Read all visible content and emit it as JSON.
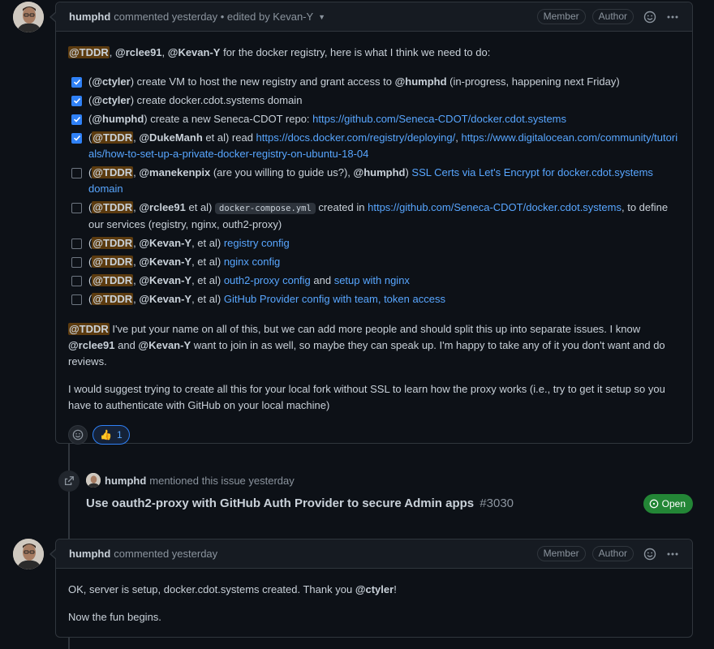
{
  "comment1": {
    "author": "humphd",
    "meta": "commented yesterday • edited by Kevan-Y",
    "badges": [
      "Member",
      "Author"
    ],
    "intro": {
      "m1": "@TDDR",
      "sep1": ", ",
      "m2": "@rclee91",
      "sep2": ", ",
      "m3": "@Kevan-Y",
      "text": " for the docker registry, here is what I think we need to do:"
    },
    "tasks": [
      {
        "checked": true,
        "prefix": "(",
        "m1": "@ctyler",
        "t1": ") create VM to host the new registry and grant access to ",
        "m2": "@humphd",
        "t2": " (in-progress, happening next Friday)"
      },
      {
        "checked": true,
        "prefix": "(",
        "m1": "@ctyler",
        "t1": ") create docker.cdot.systems domain"
      },
      {
        "checked": true,
        "prefix": "(",
        "m1": "@humphd",
        "t1": ") create a new Seneca-CDOT repo: ",
        "link1": "https://github.com/Seneca-CDOT/docker.cdot.systems"
      },
      {
        "checked": true,
        "prefix": "(",
        "m1": "@TDDR",
        "t1": ", ",
        "m2": "@DukeManh",
        "t2": " et al) read ",
        "link1": "https://docs.docker.com/registry/deploying/",
        "t3": ", ",
        "link2": "https://www.digitalocean.com/community/tutorials/how-to-set-up-a-private-docker-registry-on-ubuntu-18-04"
      },
      {
        "checked": false,
        "prefix": "(",
        "m1": "@TDDR",
        "t1": ", ",
        "m2": "@manekenpix",
        "t2": " (are you willing to guide us?), ",
        "m3": "@humphd",
        "t3": ") ",
        "link1": "SSL Certs via Let's Encrypt for docker.cdot.systems domain"
      },
      {
        "checked": false,
        "prefix": "(",
        "m1": "@TDDR",
        "t1": ", ",
        "m2": "@rclee91",
        "t2": " et al) ",
        "code": "docker-compose.yml",
        "t3": " created in ",
        "link1": "https://github.com/Seneca-CDOT/docker.cdot.systems",
        "t4": ", to define our services (registry, nginx, outh2-proxy)"
      },
      {
        "checked": false,
        "prefix": "(",
        "m1": "@TDDR",
        "t1": ", ",
        "m2": "@Kevan-Y",
        "t2": ", et al) ",
        "link1": "registry config"
      },
      {
        "checked": false,
        "prefix": "(",
        "m1": "@TDDR",
        "t1": ", ",
        "m2": "@Kevan-Y",
        "t2": ", et al) ",
        "link1": "nginx config"
      },
      {
        "checked": false,
        "prefix": "(",
        "m1": "@TDDR",
        "t1": ", ",
        "m2": "@Kevan-Y",
        "t2": ", et al) ",
        "link1": "outh2-proxy config",
        "t3": " and ",
        "link2": "setup with nginx"
      },
      {
        "checked": false,
        "prefix": "(",
        "m1": "@TDDR",
        "t1": ", ",
        "m2": "@Kevan-Y",
        "t2": ", et al) ",
        "link1": "GitHub Provider config with team, token access"
      }
    ],
    "para1": {
      "m1": "@TDDR",
      "t1": " I've put your name on all of this, but we can add more people and should split this up into separate issues. I know ",
      "m2": "@rclee91",
      "t2": " and ",
      "m3": "@Kevan-Y",
      "t3": " want to join in as well, so maybe they can speak up. I'm happy to take any of it you don't want and do reviews."
    },
    "para2": "I would suggest trying to create all this for your local fork without SSL to learn how the proxy works (i.e., try to get it setup so you have to authenticate with GitHub on your local machine)",
    "reaction": {
      "emoji": "👍",
      "count": "1"
    }
  },
  "event": {
    "author": "humphd",
    "meta": "mentioned this issue yesterday",
    "title": "Use oauth2-proxy with GitHub Auth Provider to secure Admin apps",
    "number": "#3030",
    "state": "Open"
  },
  "comment2": {
    "author": "humphd",
    "meta": "commented yesterday",
    "badges": [
      "Member",
      "Author"
    ],
    "p1_text": "OK, server is setup, docker.cdot.systems created. Thank you ",
    "p1_mention": "@ctyler",
    "p1_end": "!",
    "p2": "Now the fun begins."
  },
  "colors": {
    "background": "#0d1117",
    "header": "#161b22",
    "border": "#30363d",
    "link": "#58a6ff",
    "checkbox": "#2f81f7",
    "open_badge": "#238636",
    "mention_highlight": "#5c3b0f"
  },
  "icons": [
    "smiley-icon",
    "kebab-icon",
    "caret-down-icon",
    "check-icon",
    "cross-reference-icon",
    "issue-open-icon",
    "thumbs-up-icon"
  ]
}
